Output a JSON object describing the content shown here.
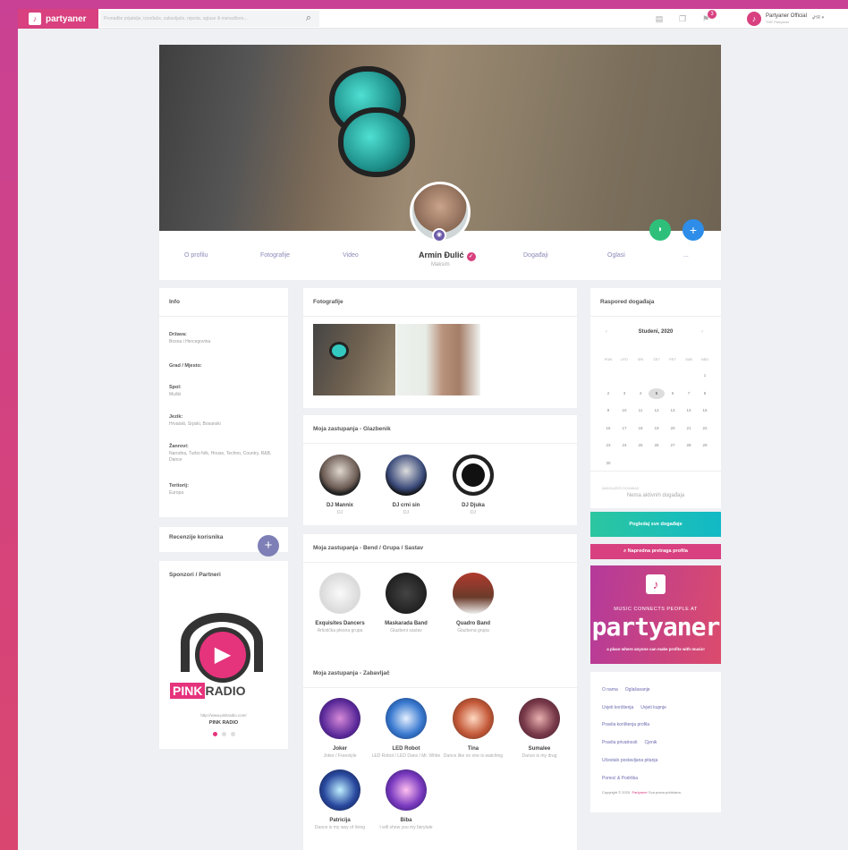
{
  "brand": {
    "name": "partyaner"
  },
  "topbar": {
    "search_placeholder": "Pronađite prijatelje, izvođače, zabavljače, mjesta, oglase ili menadžere...",
    "notification_count": "3",
    "user_name": "Partyaner Official",
    "user_sub": "THE Partyaner",
    "lang": "HR"
  },
  "profile": {
    "name": "Armin Đulić",
    "role": "Maksim",
    "tabs": [
      "O profilu",
      "Fotografije",
      "Video",
      "Događaji",
      "Oglasi",
      "..."
    ]
  },
  "info": {
    "title": "Info",
    "fields": [
      {
        "label": "Država:",
        "value": "Bosna i Hercegovina"
      },
      {
        "label": "Grad / Mjesto:",
        "value": ""
      },
      {
        "label": "Spol:",
        "value": "Muški"
      },
      {
        "label": "Jezik:",
        "value": "Hrvatski, Srpski, Bosanski"
      },
      {
        "label": "Žanrovi:",
        "value": "Narodna, Turbo folk, House, Techno, Country, R&B, Dance"
      },
      {
        "label": "Teritorij:",
        "value": "Europa"
      }
    ]
  },
  "reviews": {
    "title": "Recenzije korisnika"
  },
  "sponsors": {
    "title": "Sponzori / Partneri",
    "logo_pink": "PINK",
    "logo_radio": "RADIO",
    "url": "http://www.pinkradio.com/",
    "name": "PINK RADIO"
  },
  "photos": {
    "title": "Fotografije"
  },
  "musicians": {
    "title": "Moja zastupanja - Glazbenik",
    "items": [
      {
        "name": "DJ Mannix",
        "role": "DJ"
      },
      {
        "name": "DJ crni sin",
        "role": "DJ"
      },
      {
        "name": "DJ Djuka",
        "role": "DJ"
      }
    ]
  },
  "bands": {
    "title": "Moja zastupanja - Bend / Grupa / Sastav",
    "items": [
      {
        "name": "Exquisites Dancers",
        "role": "Artistička plesna grupa"
      },
      {
        "name": "Maskarada Band",
        "role": "Glazbeni sastav"
      },
      {
        "name": "Quadro Band",
        "role": "Glazbena grupa"
      }
    ]
  },
  "entertainers": {
    "title": "Moja zastupanja - Zabavljač",
    "items": [
      {
        "name": "Joker",
        "role": "Joker / Freestyle"
      },
      {
        "name": "LED Robot",
        "role": "LED Robot / LED Dans / Mr. White"
      },
      {
        "name": "Tina",
        "role": "Dance like no one is watching"
      },
      {
        "name": "Sumalee",
        "role": "Dance is my drug"
      },
      {
        "name": "Patricija",
        "role": "Dance is my way of living"
      },
      {
        "name": "Biba",
        "role": "I will show you my fairytale"
      }
    ]
  },
  "calendar": {
    "title": "Raspored događaja",
    "month": "Studeni, 2020",
    "dow": [
      "PON",
      "UTO",
      "SRI",
      "ČET",
      "PET",
      "SUB",
      "NED"
    ],
    "days": [
      "1",
      "2",
      "3",
      "4",
      "5",
      "6",
      "7",
      "8",
      "9",
      "10",
      "11",
      "12",
      "13",
      "14",
      "15",
      "16",
      "17",
      "18",
      "19",
      "20",
      "21",
      "22",
      "23",
      "24",
      "25",
      "26",
      "27",
      "28",
      "29",
      "30"
    ],
    "today": "5",
    "events_label": "NADOLAZEĆI DOGAĐAJI",
    "no_events": "Nema aktivnih događaja"
  },
  "buttons": {
    "all_events": "Pogledaj sve događaje",
    "advanced_search": "Napredna pretraga profila"
  },
  "promo": {
    "tagline": "MUSIC CONNECTS PEOPLE AT",
    "brand": "partyaner",
    "sub": "a place where anyone can make profits with music!"
  },
  "footer": {
    "links": [
      [
        "O nama",
        "Oglašavanje"
      ],
      [
        "Uvjeti korištenja",
        "Uvjeti kupnje"
      ],
      [
        "Pravila korištenja profila"
      ],
      [
        "Pravila privatnosti",
        "Cjenik"
      ],
      [
        "Učestalo postavljana pitanja"
      ],
      [
        "Pomoć & Podrška"
      ]
    ],
    "copyright_pre": "Copyright © 2020.",
    "copyright_brand": "Partyaner",
    "copyright_post": "Sva prava pridržana."
  },
  "colors": {
    "brand": "#d8407f",
    "teal": "#1ec0b0",
    "blue": "#2d8de8",
    "green": "#2ec07a",
    "muted": "#7d7fb6"
  }
}
